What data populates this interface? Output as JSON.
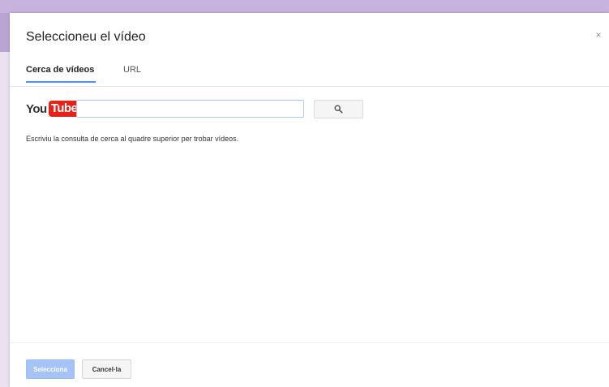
{
  "dialog": {
    "title": "Seleccioneu el vídeo",
    "close_icon": "close-icon",
    "close_glyph": "×"
  },
  "tabs": [
    {
      "label": "Cerca de vídeos",
      "active": true
    },
    {
      "label": "URL",
      "active": false
    }
  ],
  "search": {
    "logo_you": "You",
    "logo_tube": "Tube",
    "value": "",
    "placeholder": "",
    "button_icon": "search-icon"
  },
  "hint": "Escriviu la consulta de cerca al quadre superior per trobar vídeos.",
  "footer": {
    "select_label": "Selecciona",
    "cancel_label": "Cancel·la"
  },
  "colors": {
    "accent": "#4d90fe",
    "select_button": "#a6c3f7",
    "youtube_red": "#e62117",
    "background_strip": "#c7b3dd"
  }
}
